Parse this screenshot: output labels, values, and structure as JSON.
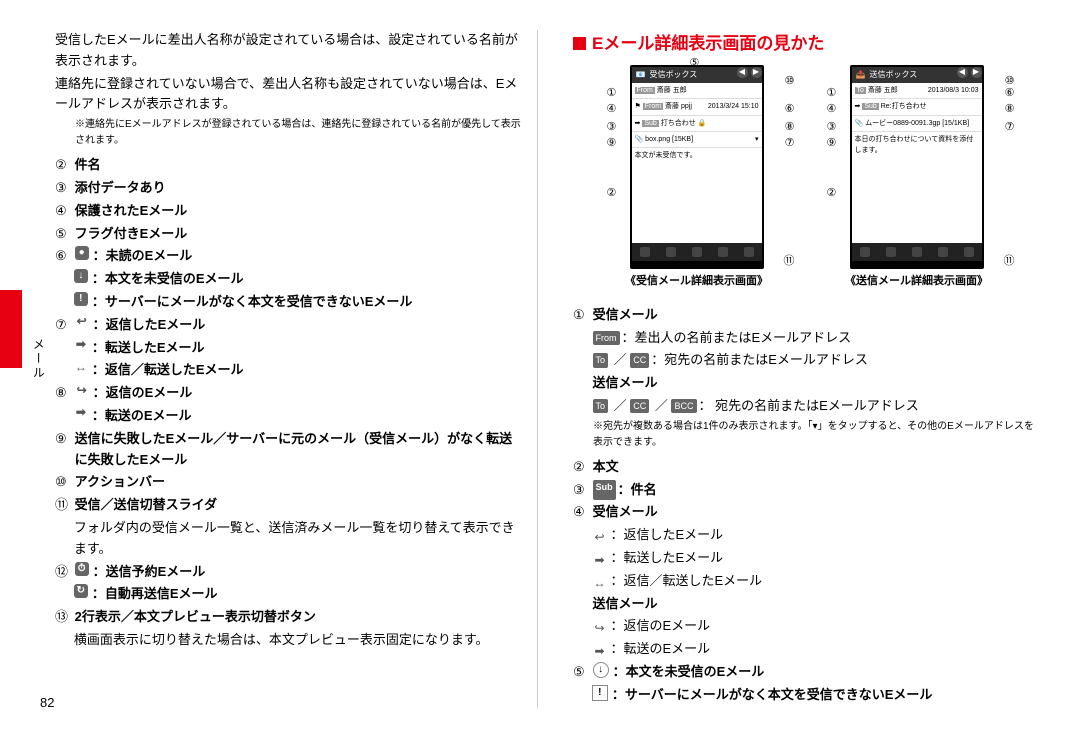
{
  "sideLabel": "メール",
  "left": {
    "para1": "受信したEメールに差出人名称が設定されている場合は、設定されている名前が表示されます。",
    "para2": "連絡先に登録されていない場合で、差出人名称も設定されていない場合は、Eメールアドレスが表示されます。",
    "note1": "※連絡先にEメールアドレスが登録されている場合は、連絡先に登録されている名前が優先して表示されます。",
    "i2": "件名",
    "i3": "添付データあり",
    "i4": "保護されたEメール",
    "i5": "フラグ付きEメール",
    "i6a": "：未読のEメール",
    "i6b": "：本文を未受信のEメール",
    "i6c": "：サーバーにメールがなく本文を受信できないEメール",
    "i7a": "：返信したEメール",
    "i7b": "：転送したEメール",
    "i7c": "：返信／転送したEメール",
    "i8a": "：返信のEメール",
    "i8b": "：転送のEメール",
    "i9": "送信に失敗したEメール／サーバーに元のメール（受信メール）がなく転送に失敗したEメール",
    "i10": "アクションバー",
    "i11": "受信／送信切替スライダ",
    "i11desc": "フォルダ内の受信メール一覧と、送信済みメール一覧を切り替えて表示できます。",
    "i12a": "：送信予約Eメール",
    "i12b": "：自動再送信Eメール",
    "i13": "2行表示／本文プレビュー表示切替ボタン",
    "i13desc": "横画面表示に切り替えた場合は、本文プレビュー表示固定になります。"
  },
  "right": {
    "title": "Eメール詳細表示画面の見かた",
    "phone1cap": "《受信メール詳細表示画面》",
    "phone2cap": "《送信メール詳細表示画面》",
    "boxLabel": "受信ボックス",
    "boxLabel2": "送信ボックス",
    "phFrom1": "斎藤 五郎",
    "phFrom2": "斎藤 ppjj",
    "phDate1": "2013/3/24  15:10",
    "phSubj1": "打ち合わせ",
    "phAttach1": "box.png [15KB]",
    "phBody1": "本文が未受信です。",
    "phFrom3": "斎藤 五郎",
    "phDate2": "2013/08/3  10:03",
    "phSubj2": "Re:打ち合わせ",
    "phAttach2": "ムービー0889-0091.3gp [15/1KB]",
    "phBody2": "本日の打ち合わせについて資料を添付します。",
    "r1": "受信メール",
    "r1a": "：差出人の名前またはEメールアドレス",
    "r1b": "：宛先の名前またはEメールアドレス",
    "r1send": "送信メール",
    "r1c": "： 宛先の名前またはEメールアドレス",
    "r1note": "※宛先が複数ある場合は1件のみ表示されます。「▾」をタップすると、その他のEメールアドレスを表示できます。",
    "r2": "本文",
    "r3": "：件名",
    "r4": "受信メール",
    "r4a": "：返信したEメール",
    "r4b": "：転送したEメール",
    "r4c": "：返信／転送したEメール",
    "r4send": "送信メール",
    "r4d": "：返信のEメール",
    "r4e": "：転送のEメール",
    "r5a": "：本文を未受信のEメール",
    "r5b": "：サーバーにメールがなく本文を受信できないEメール"
  },
  "pageNum": "82"
}
